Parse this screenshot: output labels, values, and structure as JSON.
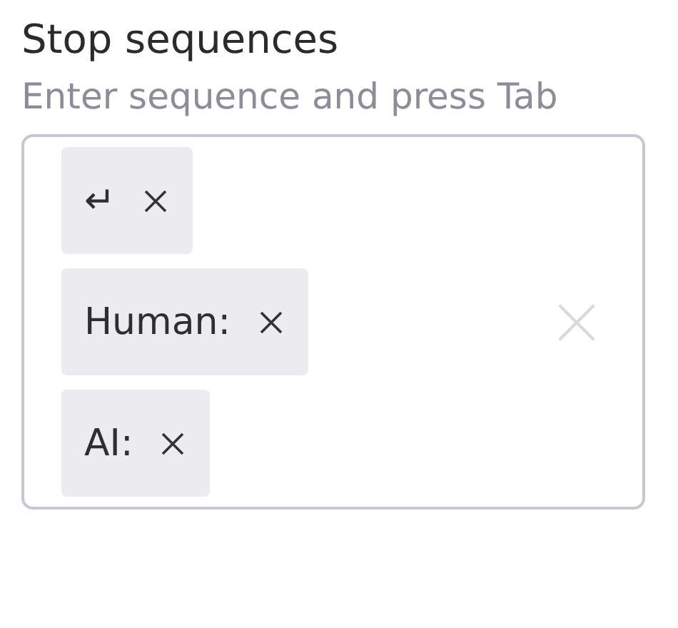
{
  "label": "Stop sequences",
  "hint": "Enter sequence and press Tab",
  "sequences": [
    {
      "text": "↵"
    },
    {
      "text": "Human:"
    },
    {
      "text": "AI:"
    }
  ]
}
